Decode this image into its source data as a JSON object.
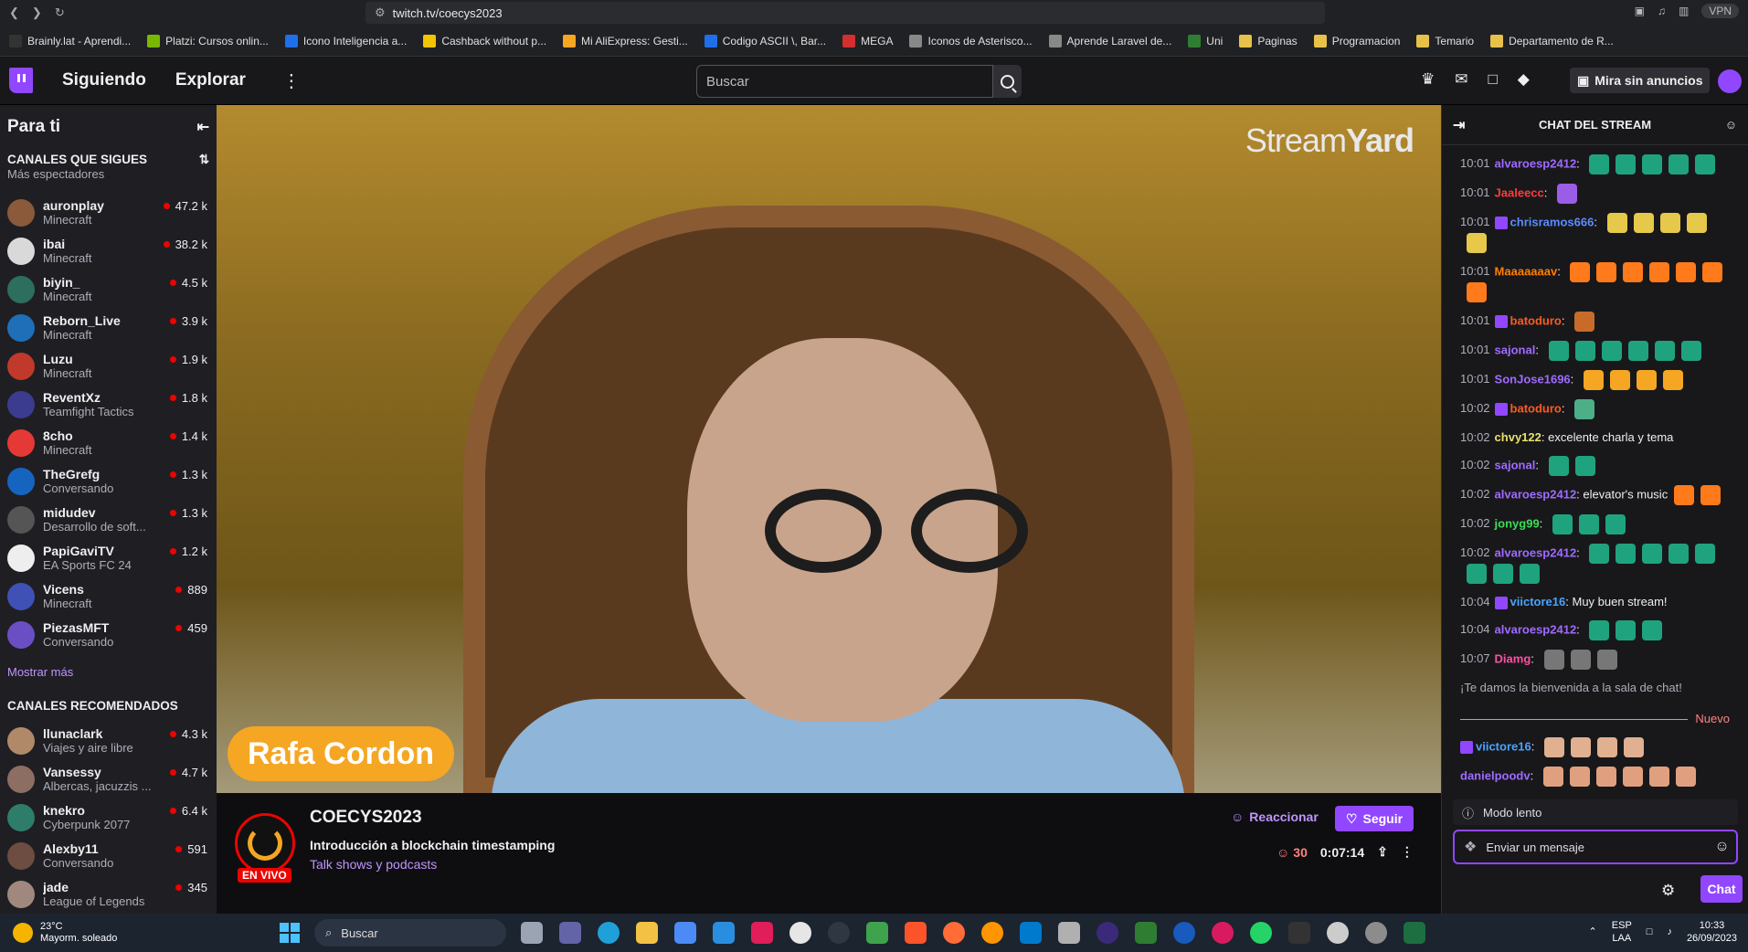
{
  "browser": {
    "url": "twitch.tv/coecys2023",
    "vpn_label": "VPN",
    "bookmarks": [
      "Brainly.lat - Aprendi...",
      "Platzi: Cursos onlin...",
      "Icono Inteligencia a...",
      "Cashback without p...",
      "Mi AliExpress: Gesti...",
      "Codigo ASCII \\, Bar...",
      "MEGA",
      "Iconos de Asterisco...",
      "Aprende Laravel de...",
      "Uni",
      "Paginas",
      "Programacion",
      "Temario",
      "Departamento de R..."
    ]
  },
  "nav": {
    "following": "Siguiendo",
    "explore": "Explorar",
    "search_placeholder": "Buscar",
    "ad_free": "Mira sin anuncios"
  },
  "sidebar": {
    "title": "Para ti",
    "followed_title": "CANALES QUE SIGUES",
    "followed_sub": "Más espectadores",
    "followed": [
      {
        "name": "auronplay",
        "game": "Minecraft",
        "viewers": "47.2 k",
        "color": "#8a5a3a"
      },
      {
        "name": "ibai",
        "game": "Minecraft",
        "viewers": "38.2 k",
        "color": "#d9d9d9"
      },
      {
        "name": "biyin_",
        "game": "Minecraft",
        "viewers": "4.5 k",
        "color": "#2d6e5e"
      },
      {
        "name": "Reborn_Live",
        "game": "Minecraft",
        "viewers": "3.9 k",
        "color": "#1e6fb8"
      },
      {
        "name": "Luzu",
        "game": "Minecraft",
        "viewers": "1.9 k",
        "color": "#c0392b"
      },
      {
        "name": "ReventXz",
        "game": "Teamfight Tactics",
        "viewers": "1.8 k",
        "color": "#3b3b8f"
      },
      {
        "name": "8cho",
        "game": "Minecraft",
        "viewers": "1.4 k",
        "color": "#e53935"
      },
      {
        "name": "TheGrefg",
        "game": "Conversando",
        "viewers": "1.3 k",
        "color": "#1565c0"
      },
      {
        "name": "midudev",
        "game": "Desarrollo de soft...",
        "viewers": "1.3 k",
        "color": "#555555"
      },
      {
        "name": "PapiGaviTV",
        "game": "EA Sports FC 24",
        "viewers": "1.2 k",
        "color": "#eeeeee"
      },
      {
        "name": "Vicens",
        "game": "Minecraft",
        "viewers": "889",
        "color": "#3f51b5"
      },
      {
        "name": "PiezasMFT",
        "game": "Conversando",
        "viewers": "459",
        "color": "#6a4fc4"
      }
    ],
    "show_more": "Mostrar más",
    "recommended_title": "CANALES RECOMENDADOS",
    "recommended": [
      {
        "name": "llunaclark",
        "game": "Viajes y aire libre",
        "viewers": "4.3 k",
        "color": "#b08968"
      },
      {
        "name": "Vansessy",
        "game": "Albercas, jacuzzis ...",
        "viewers": "4.7 k",
        "color": "#8d6e63"
      },
      {
        "name": "knekro",
        "game": "Cyberpunk 2077",
        "viewers": "6.4 k",
        "color": "#2e7d6b"
      },
      {
        "name": "Alexby11",
        "game": "Conversando",
        "viewers": "591",
        "color": "#6d4c41"
      },
      {
        "name": "jade",
        "game": "League of Legends",
        "viewers": "345",
        "color": "#a1887f"
      }
    ]
  },
  "video": {
    "watermark_a": "Stream",
    "watermark_b": "Yard",
    "nameplate": "Rafa Cordon"
  },
  "stream": {
    "channel": "COECYS2023",
    "live": "EN VIVO",
    "title": "Introducción a blockchain timestamping",
    "category": "Talk shows y podcasts",
    "react": "Reaccionar",
    "follow": "Seguir",
    "viewers": "30",
    "uptime": "0:07:14"
  },
  "chat": {
    "title": "CHAT DEL STREAM",
    "messages": [
      {
        "time": "10:01",
        "user": "alvaroesp2412",
        "color": "#9f6bff",
        "text": "",
        "emotes": 5,
        "emote_color": "#1fa37f",
        "badge": false
      },
      {
        "time": "10:01",
        "user": "Jaaleecc",
        "color": "#ff3b3b",
        "text": "",
        "emotes": 1,
        "emote_color": "#9b5de5",
        "badge": false
      },
      {
        "time": "10:01",
        "user": "chrisramos666",
        "color": "#5c8bff",
        "text": "",
        "emotes": 5,
        "emote_color": "#e6c84a",
        "badge": true
      },
      {
        "time": "10:01",
        "user": "Maaaaaaav",
        "color": "#ff7f00",
        "text": "",
        "emotes": 7,
        "emote_color": "#ff7a1a",
        "badge": false
      },
      {
        "time": "10:01",
        "user": "batoduro",
        "color": "#ff5a1f",
        "text": "",
        "emotes": 1,
        "emote_color": "#c86b2a",
        "badge": true
      },
      {
        "time": "10:01",
        "user": "sajonal",
        "color": "#9f6bff",
        "text": "",
        "emotes": 6,
        "emote_color": "#1fa37f",
        "badge": false
      },
      {
        "time": "10:01",
        "user": "SonJose1696",
        "color": "#9f6bff",
        "text": "",
        "emotes": 4,
        "emote_color": "#f5a623",
        "badge": false
      },
      {
        "time": "10:02",
        "user": "batoduro",
        "color": "#ff5a1f",
        "text": "",
        "emotes": 1,
        "emote_color": "#4caf88",
        "badge": true
      },
      {
        "time": "10:02",
        "user": "chvy122",
        "color": "#e7e36a",
        "text": "excelente charla y tema",
        "emotes": 0,
        "emote_color": "",
        "badge": false
      },
      {
        "time": "10:02",
        "user": "sajonal",
        "color": "#9f6bff",
        "text": "",
        "emotes": 2,
        "emote_color": "#1fa37f",
        "badge": false
      },
      {
        "time": "10:02",
        "user": "alvaroesp2412",
        "color": "#9f6bff",
        "text": "elevator's music",
        "emotes": 2,
        "emote_color": "#ff7a1a",
        "badge": false
      },
      {
        "time": "10:02",
        "user": "jonyg99",
        "color": "#3ddc57",
        "text": "",
        "emotes": 3,
        "emote_color": "#1fa37f",
        "badge": false
      },
      {
        "time": "10:02",
        "user": "alvaroesp2412",
        "color": "#9f6bff",
        "text": "",
        "emotes": 8,
        "emote_color": "#1fa37f",
        "badge": false
      },
      {
        "time": "10:04",
        "user": "viictore16",
        "color": "#4aa3ff",
        "text": "Muy buen stream!",
        "emotes": 0,
        "emote_color": "",
        "badge": true
      },
      {
        "time": "10:04",
        "user": "alvaroesp2412",
        "color": "#9f6bff",
        "text": "",
        "emotes": 3,
        "emote_color": "#1fa37f",
        "badge": false
      },
      {
        "time": "10:07",
        "user": "Diamg",
        "color": "#ff4fa3",
        "text": "",
        "emotes": 3,
        "emote_color": "#777777",
        "badge": false
      }
    ],
    "welcome": "¡Te damos la bienvenida a la sala de chat!",
    "new_label": "Nuevo",
    "new_messages": [
      {
        "time": "",
        "user": "viictore16",
        "color": "#4aa3ff",
        "text": "",
        "emotes": 4,
        "emote_color": "#e0b090",
        "badge": true
      },
      {
        "time": "",
        "user": "danielpoodv",
        "color": "#9f6bff",
        "text": "",
        "emotes": 6,
        "emote_color": "#e0a080",
        "badge": false
      }
    ],
    "slow_mode": "Modo lento",
    "input_placeholder": "Enviar un mensaje",
    "send": "Chat"
  },
  "taskbar": {
    "temp": "23°C",
    "weather": "Mayorm. soleado",
    "search": "Buscar",
    "lang_a": "ESP",
    "lang_b": "LAA",
    "time": "10:33",
    "date": "26/09/2023"
  }
}
